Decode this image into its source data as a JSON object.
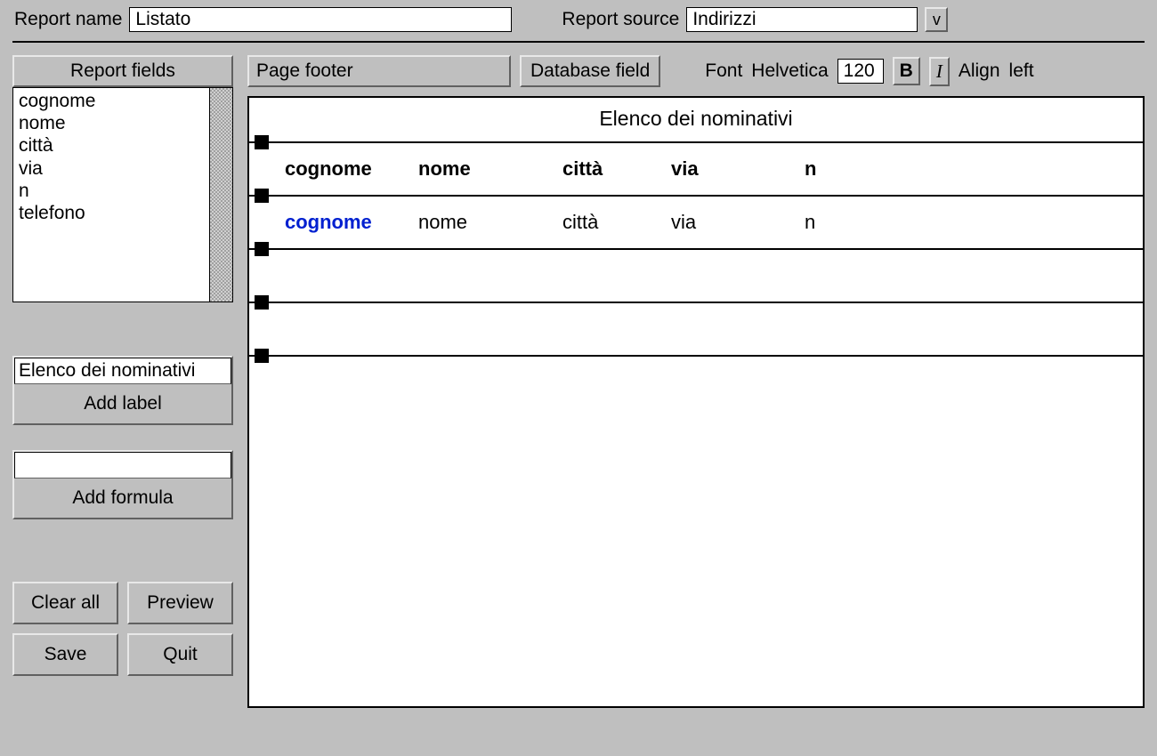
{
  "header": {
    "report_name_label": "Report name",
    "report_name_value": "Listato",
    "report_source_label": "Report source",
    "report_source_value": "Indirizzi",
    "dropdown_glyph": "v"
  },
  "sidebar": {
    "fields_header": "Report fields",
    "fields": [
      "cognome",
      "nome",
      "città",
      "via",
      "n",
      "telefono"
    ],
    "label_input_value": "Elenco dei nominativi",
    "add_label_btn": "Add label",
    "formula_input_value": "",
    "add_formula_btn": "Add formula",
    "clear_all_btn": "Clear all",
    "preview_btn": "Preview",
    "save_btn": "Save",
    "quit_btn": "Quit"
  },
  "toolbar": {
    "section_selector": "Page footer",
    "field_type": "Database field",
    "font_label": "Font",
    "font_value": "Helvetica",
    "size_value": "120",
    "bold_btn": "B",
    "italic_btn": "I",
    "align_label": "Align",
    "align_value": "left"
  },
  "canvas": {
    "title": "Elenco dei nominativi",
    "header_row": [
      "cognome",
      "nome",
      "città",
      "via",
      "n"
    ],
    "data_row": [
      "cognome",
      "nome",
      "città",
      "via",
      "n"
    ],
    "selected_index": 0
  }
}
